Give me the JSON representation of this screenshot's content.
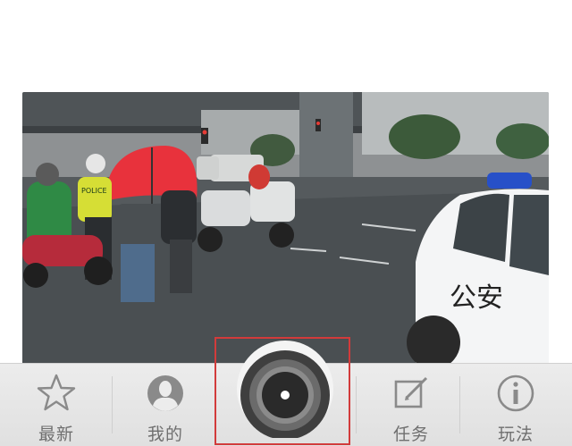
{
  "tabbar": {
    "tabs": [
      {
        "id": "latest",
        "label": "最新",
        "icon": "star-icon"
      },
      {
        "id": "mine",
        "label": "我的",
        "icon": "profile-icon"
      },
      {
        "id": "camera",
        "label": "",
        "icon": "camera-shutter-icon"
      },
      {
        "id": "tasks",
        "label": "任务",
        "icon": "edit-icon"
      },
      {
        "id": "play",
        "label": "玩法",
        "icon": "info-icon"
      }
    ]
  },
  "photo": {
    "vehicle_text": "公安",
    "sign_text": "POLICE"
  },
  "colors": {
    "highlight_border": "#d23b3b",
    "tab_label": "#6f6f6f",
    "umbrella": "#e8323c"
  }
}
